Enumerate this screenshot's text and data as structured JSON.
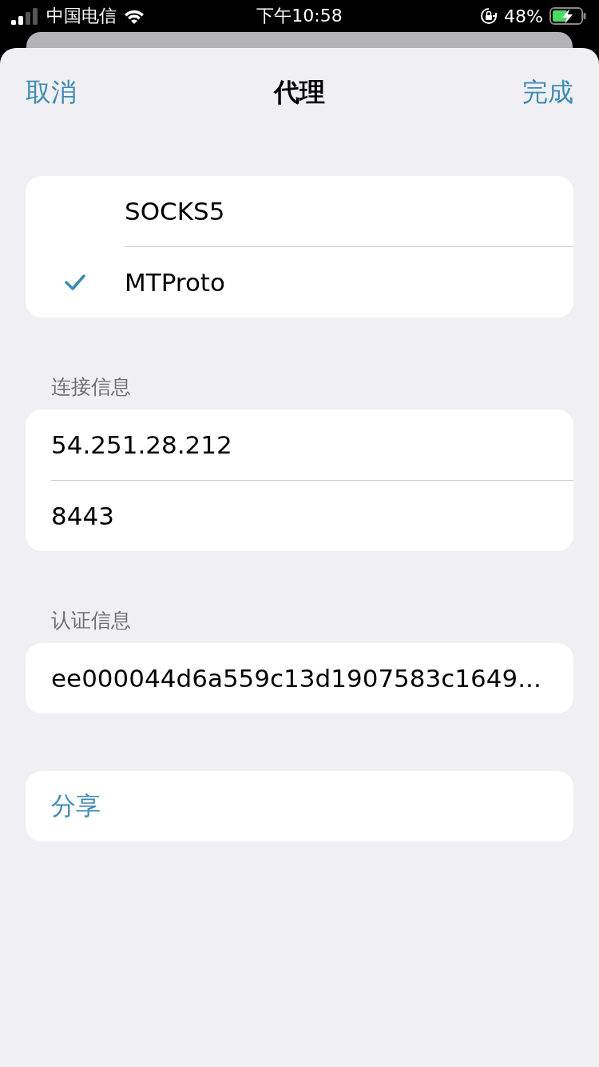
{
  "status_bar": {
    "carrier": "中国电信",
    "time": "下午10:58",
    "battery": "48%"
  },
  "nav": {
    "cancel": "取消",
    "title": "代理",
    "done": "完成"
  },
  "protocols": [
    {
      "label": "SOCKS5",
      "selected": false
    },
    {
      "label": "MTProto",
      "selected": true
    }
  ],
  "sections": [
    {
      "header": "连接信息",
      "fields": [
        {
          "value": "54.251.28.212"
        },
        {
          "value": "8443"
        }
      ]
    },
    {
      "header": "认证信息",
      "fields": [
        {
          "value": "ee000044d6a559c13d1907583c1649..."
        }
      ]
    }
  ],
  "share": "分享"
}
